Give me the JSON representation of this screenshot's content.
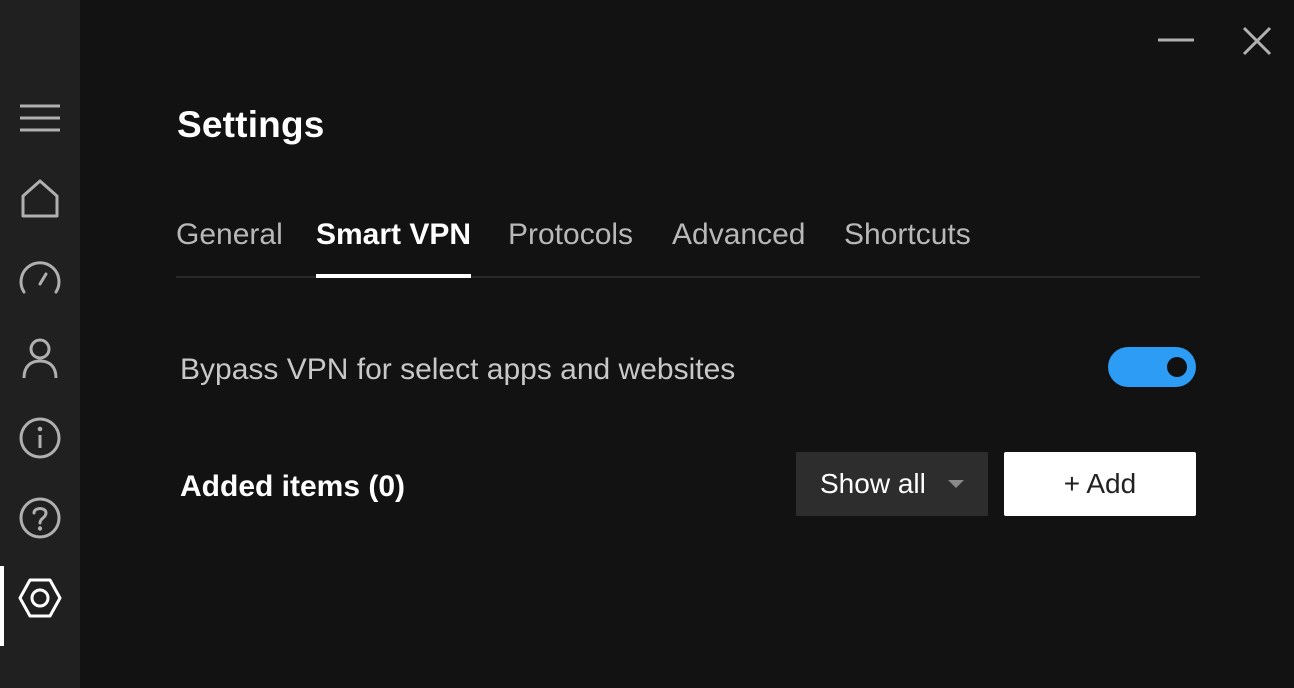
{
  "sidebar": {
    "items": [
      {
        "name": "menu",
        "icon": "hamburger-menu-icon"
      },
      {
        "name": "home",
        "icon": "home-icon"
      },
      {
        "name": "speed-test",
        "icon": "speedometer-icon"
      },
      {
        "name": "account",
        "icon": "user-icon"
      },
      {
        "name": "about",
        "icon": "info-icon"
      },
      {
        "name": "help",
        "icon": "help-icon"
      },
      {
        "name": "settings",
        "icon": "settings-hex-icon",
        "active": true
      }
    ]
  },
  "window": {
    "minimize_icon": "minimize-icon",
    "close_icon": "close-icon"
  },
  "page": {
    "title": "Settings"
  },
  "tabs": [
    {
      "label": "General",
      "active": false
    },
    {
      "label": "Smart VPN",
      "active": true
    },
    {
      "label": "Protocols",
      "active": false
    },
    {
      "label": "Advanced",
      "active": false
    },
    {
      "label": "Shortcuts",
      "active": false
    }
  ],
  "smart_vpn": {
    "bypass_label": "Bypass VPN for select apps and websites",
    "bypass_enabled": true,
    "items_label": "Added items (0)",
    "filter_value": "Show all",
    "add_label": "+ Add"
  },
  "colors": {
    "background": "#121212",
    "sidebar": "#202020",
    "accent": "#2c9cf5",
    "tab_inactive": "#b8b8b8"
  }
}
